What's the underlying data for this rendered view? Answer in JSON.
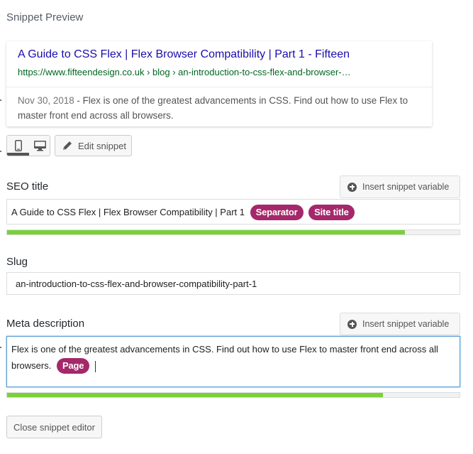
{
  "heading": "Snippet Preview",
  "preview": {
    "title": "A Guide to CSS Flex | Flex Browser Compatibility | Part 1 - Fifteen",
    "url": "https://www.fifteendesign.co.uk › blog › an-introduction-to-css-flex-and-browser-…",
    "date": "Nov 30, 2018",
    "date_separator": " - ",
    "description": "Flex is one of the greatest advancements in CSS. Find out how to use Flex to master front end across all browsers."
  },
  "mode_switcher": {
    "mobile_icon": "mobile-icon",
    "desktop_icon": "desktop-icon",
    "active": "mobile"
  },
  "edit_snippet": {
    "icon": "pencil-icon",
    "label": "Edit snippet"
  },
  "seo_title": {
    "label": "SEO title",
    "insert_button": "Insert snippet variable",
    "text": "A Guide to CSS Flex | Flex Browser Compatibility | Part 1",
    "variables": [
      "Separator",
      "Site title"
    ],
    "progress_percent": 88,
    "progress_color": "#7ad03a"
  },
  "slug": {
    "label": "Slug",
    "value": "an-introduction-to-css-flex-and-browser-compatibility-part-1"
  },
  "meta_description": {
    "label": "Meta description",
    "insert_button": "Insert snippet variable",
    "text": "Flex is one of the greatest advancements in CSS. Find out how to use Flex to master front end across all browsers.",
    "variables": [
      "Page"
    ],
    "progress_percent": 83,
    "progress_color": "#7ad03a"
  },
  "close_button": "Close snippet editor",
  "colors": {
    "pill": "#a4286a",
    "link_title": "#1a0dab",
    "link_url": "#006621",
    "focus_border": "#5b9dd9"
  }
}
